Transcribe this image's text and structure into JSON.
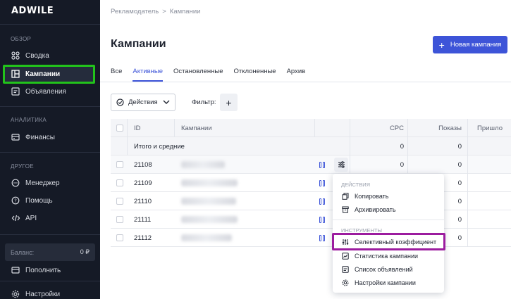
{
  "brand": {
    "logo_text": "ADWILE"
  },
  "sidebar": {
    "sections": {
      "overview": "ОБЗОР",
      "analytics": "АНАЛИТИКА",
      "other": "ДРУГОЕ"
    },
    "items": [
      {
        "label": "Сводка",
        "icon": "grid-icon"
      },
      {
        "label": "Кампании",
        "icon": "layout-icon",
        "active": true
      },
      {
        "label": "Объявления",
        "icon": "ad-icon"
      },
      {
        "label": "Финансы",
        "icon": "wallet-icon"
      },
      {
        "label": "Менеджер",
        "icon": "chat-icon"
      },
      {
        "label": "Помощь",
        "icon": "help-icon"
      },
      {
        "label": "API",
        "icon": "code-icon"
      },
      {
        "label": "Пополнить",
        "icon": "topup-icon"
      },
      {
        "label": "Настройки",
        "icon": "gear-icon"
      }
    ],
    "balance": {
      "label": "Баланс:",
      "value": "0 ₽"
    }
  },
  "breadcrumb": {
    "parent": "Рекламодатель",
    "current": "Кампании"
  },
  "page_title": "Кампании",
  "new_campaign_button": "Новая кампания",
  "tabs": [
    {
      "label": "Все"
    },
    {
      "label": "Активные",
      "active": true
    },
    {
      "label": "Остановленные"
    },
    {
      "label": "Отклоненные"
    },
    {
      "label": "Архив"
    }
  ],
  "toolbar": {
    "actions_label": "Действия",
    "filter_label": "Фильтр:"
  },
  "table": {
    "columns": {
      "id": "ID",
      "name": "Кампании",
      "cpc": "CPC",
      "views": "Показы",
      "visits": "Пришло"
    },
    "totals": {
      "label": "Итого и средние",
      "cpc": "0",
      "views": "0"
    },
    "rows": [
      {
        "id": "21108",
        "cpc": "0",
        "views": "0"
      },
      {
        "id": "21109",
        "cpc": "",
        "views": "0"
      },
      {
        "id": "21110",
        "cpc": "",
        "views": "0"
      },
      {
        "id": "21111",
        "cpc": "",
        "views": "0"
      },
      {
        "id": "21112",
        "cpc": "",
        "views": "0"
      }
    ]
  },
  "menu": {
    "group_actions": "ДЕЙСТВИЯ",
    "copy": "Копировать",
    "archive": "Архивировать",
    "group_tools": "ИНСТРУМЕНТЫ",
    "selective": "Селективный коэффициент",
    "stats": "Статистика кампании",
    "ads_list": "Список объявлений",
    "settings": "Настройки кампании"
  },
  "colors": {
    "accent": "#3d54d8",
    "sidebar_bg": "#151a26",
    "highlight_green": "#22c31b",
    "highlight_purple": "#9c1c9f"
  }
}
